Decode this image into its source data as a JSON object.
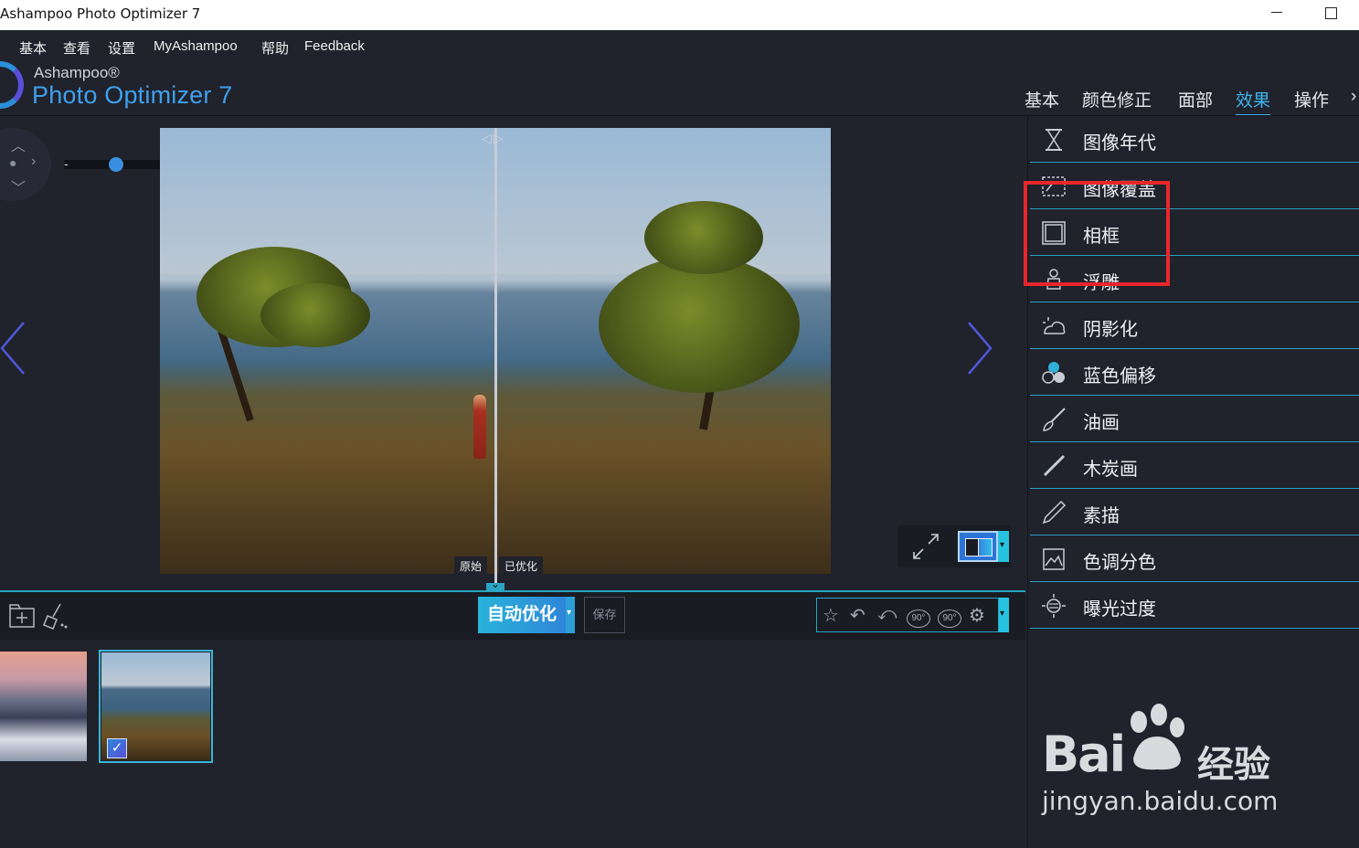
{
  "window": {
    "title": "Ashampoo Photo Optimizer 7"
  },
  "menu": [
    "基本",
    "查看",
    "设置",
    "MyAshampoo",
    "帮助",
    "Feedback"
  ],
  "logo": {
    "brand": "Ashampoo®",
    "product": "Photo Optimizer 7"
  },
  "tabs": [
    {
      "label": "基本",
      "active": false
    },
    {
      "label": "颜色修正",
      "active": false
    },
    {
      "label": "面部",
      "active": false
    },
    {
      "label": "效果",
      "active": true
    },
    {
      "label": "操作",
      "active": false
    }
  ],
  "viewer": {
    "label_original": "原始",
    "label_optimized": "已优化",
    "zoom_minus": "-",
    "zoom_plus": "+",
    "zoom_level": 0.33
  },
  "toolbar": {
    "auto_optimize": "自动优化",
    "save": "保存",
    "rotate_left_label": "90°",
    "rotate_right_label": "90°"
  },
  "effects": [
    {
      "label": "图像年代",
      "icon": "hourglass-icon"
    },
    {
      "label": "图像覆盖",
      "icon": "overlay-icon"
    },
    {
      "label": "相框",
      "icon": "frame-icon"
    },
    {
      "label": "浮雕",
      "icon": "emboss-icon"
    },
    {
      "label": "阴影化",
      "icon": "shadow-icon"
    },
    {
      "label": "蓝色偏移",
      "icon": "blue-shift-icon"
    },
    {
      "label": "油画",
      "icon": "brush-icon"
    },
    {
      "label": "木炭画",
      "icon": "charcoal-icon"
    },
    {
      "label": "素描",
      "icon": "pencil-icon"
    },
    {
      "label": "色调分色",
      "icon": "posterize-icon"
    },
    {
      "label": "曝光过度",
      "icon": "overexpose-icon"
    }
  ],
  "watermark": {
    "brand": "Bai",
    "brand2": "经验",
    "url": "jingyan.baidu.com"
  },
  "colors": {
    "accent": "#2aa5c4",
    "highlight": "#e8272d",
    "background": "#20222c"
  }
}
